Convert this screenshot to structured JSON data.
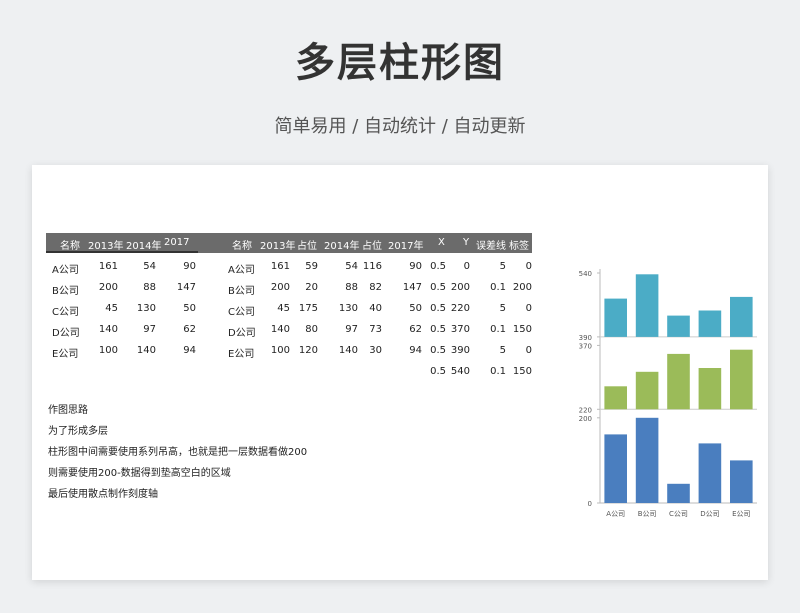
{
  "header": {
    "title": "多层柱形图",
    "subtitle": "简单易用 / 自动统计 / 自动更新"
  },
  "table1": {
    "headers": [
      "名称",
      "2013年",
      "2014年",
      "2017年"
    ],
    "rows": [
      [
        "A公司",
        "161",
        "54",
        "90"
      ],
      [
        "B公司",
        "200",
        "88",
        "147"
      ],
      [
        "C公司",
        "45",
        "130",
        "50"
      ],
      [
        "D公司",
        "140",
        "97",
        "62"
      ],
      [
        "E公司",
        "100",
        "140",
        "94"
      ]
    ]
  },
  "table2": {
    "headers": [
      "名称",
      "2013年",
      "占位",
      "2014年",
      "占位",
      "2017年",
      "X",
      "Y",
      "误差线",
      "标签"
    ],
    "rows": [
      [
        "A公司",
        "161",
        "59",
        "54",
        "116",
        "90",
        "0.5",
        "0",
        "5",
        "0"
      ],
      [
        "B公司",
        "200",
        "20",
        "88",
        "82",
        "147",
        "0.5",
        "200",
        "0.1",
        "200"
      ],
      [
        "C公司",
        "45",
        "175",
        "130",
        "40",
        "50",
        "0.5",
        "220",
        "5",
        "0"
      ],
      [
        "D公司",
        "140",
        "80",
        "97",
        "73",
        "62",
        "0.5",
        "370",
        "0.1",
        "150"
      ],
      [
        "E公司",
        "100",
        "120",
        "140",
        "30",
        "94",
        "0.5",
        "390",
        "5",
        "0"
      ],
      [
        "",
        "",
        "",
        "",
        "",
        "",
        "0.5",
        "540",
        "0.1",
        "150"
      ]
    ]
  },
  "notes": [
    "作图思路",
    "为了形成多层",
    "柱形图中间需要使用系列吊高，也就是把一层数据看做200",
    "则需要使用200-数据得到垫高空白的区域",
    "最后使用散点制作刻度轴"
  ],
  "chart_data": {
    "type": "bar",
    "categories": [
      "A公司",
      "B公司",
      "C公司",
      "D公司",
      "E公司"
    ],
    "series": [
      {
        "name": "2013年",
        "values": [
          161,
          200,
          45,
          140,
          100
        ],
        "color": "#4a7ebf"
      },
      {
        "name": "2014年",
        "values": [
          54,
          88,
          130,
          97,
          140
        ],
        "color": "#9bbb59"
      },
      {
        "name": "2017年",
        "values": [
          90,
          147,
          50,
          62,
          94
        ],
        "color": "#4bacc6"
      }
    ],
    "layers": [
      {
        "series": "2013年",
        "base": 0,
        "top": 200
      },
      {
        "series": "2014年",
        "base": 220,
        "top": 370
      },
      {
        "series": "2017年",
        "base": 390,
        "top": 540
      }
    ],
    "tick_labels": [
      "0",
      "200",
      "220",
      "370",
      "390",
      "540"
    ],
    "ylim": [
      0,
      540
    ],
    "grid": false,
    "legend": "none"
  }
}
